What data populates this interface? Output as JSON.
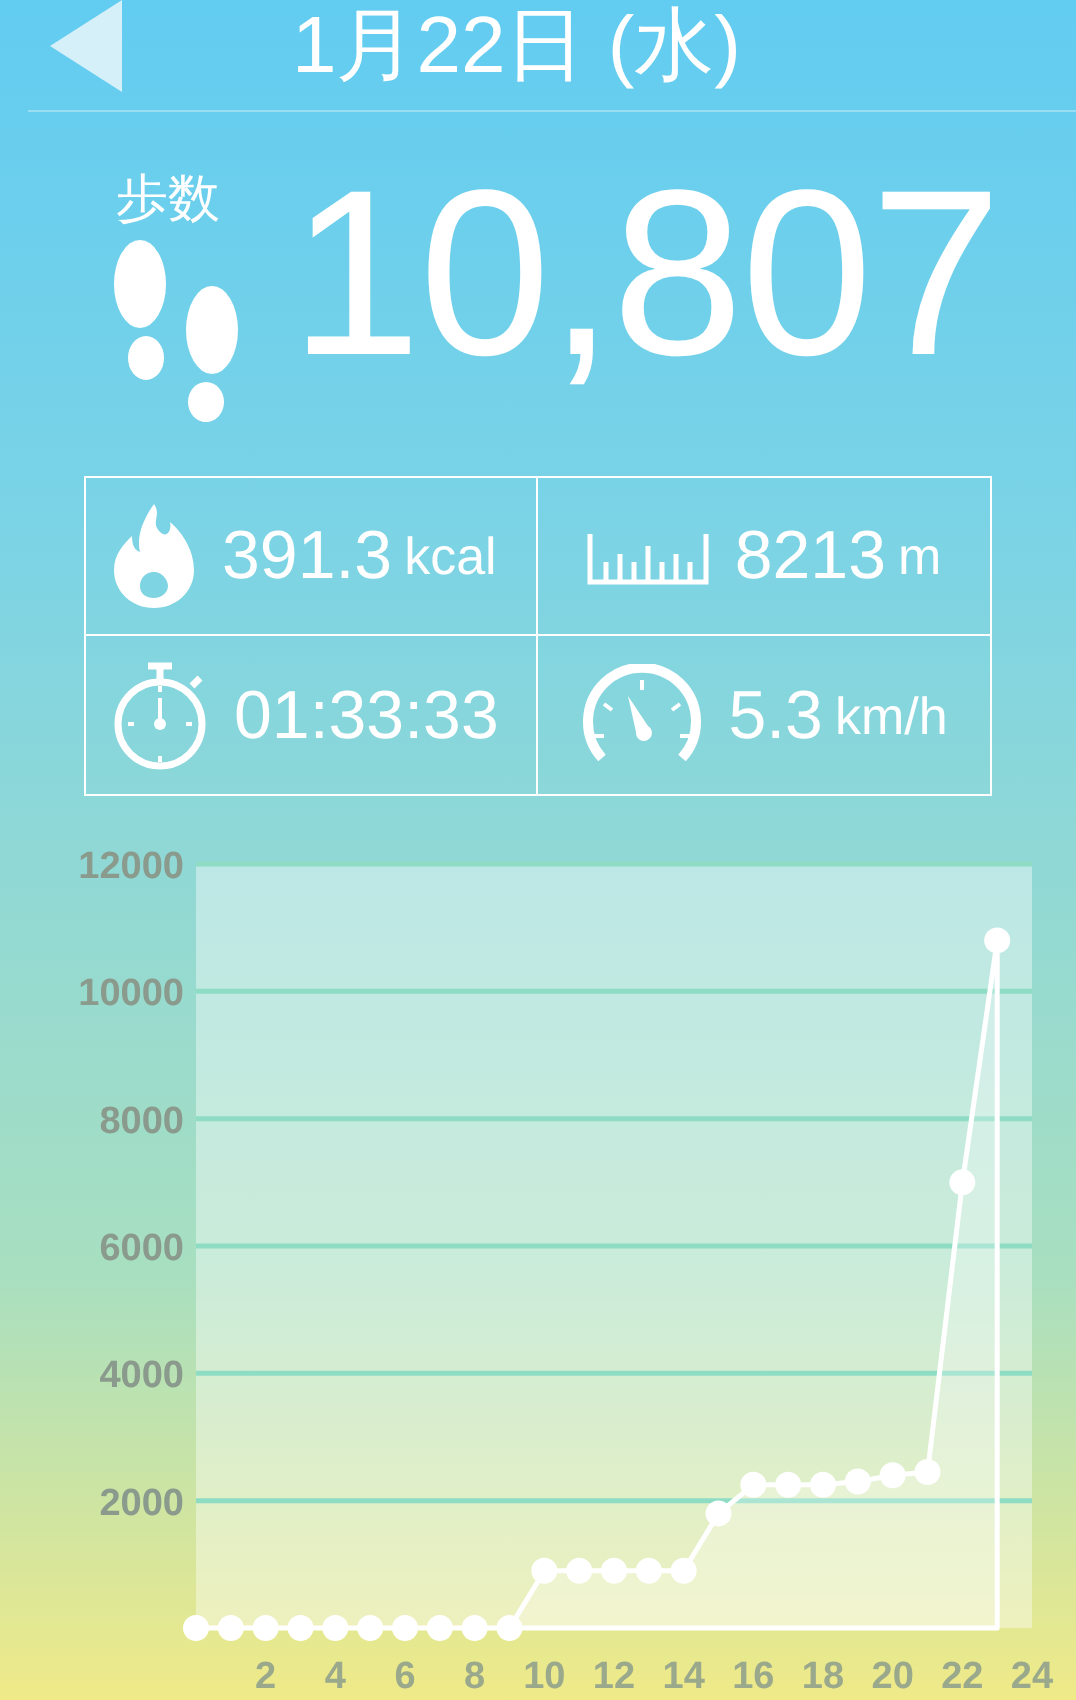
{
  "header": {
    "title": "1月22日 (水)"
  },
  "steps": {
    "label": "歩数",
    "value": "10,807"
  },
  "stats": [
    {
      "kind": "calories",
      "value": "391.3",
      "unit": "kcal"
    },
    {
      "kind": "distance",
      "value": "8213",
      "unit": "m"
    },
    {
      "kind": "time",
      "value": "01:33:33"
    },
    {
      "kind": "speed",
      "value": "5.3",
      "unit": "km/h"
    }
  ],
  "chart": {
    "chart_data": {
      "type": "area",
      "x": [
        0,
        1,
        2,
        3,
        4,
        5,
        6,
        7,
        8,
        9,
        10,
        11,
        12,
        13,
        14,
        15,
        16,
        17,
        18,
        19,
        20,
        21,
        22,
        23
      ],
      "series": [
        {
          "color": "#ffffff",
          "values": [
            0,
            0,
            0,
            0,
            0,
            0,
            0,
            0,
            0,
            0,
            900,
            900,
            900,
            900,
            900,
            1800,
            2250,
            2250,
            2250,
            2300,
            2400,
            2450,
            7000,
            10800
          ]
        }
      ],
      "grid": true,
      "xlim": [
        0,
        24
      ],
      "ylim": [
        0,
        12000
      ],
      "xticks": [
        2,
        4,
        6,
        8,
        10,
        12,
        14,
        16,
        18,
        20,
        22,
        24
      ],
      "yticks": [
        2000,
        4000,
        6000,
        8000,
        10000,
        12000
      ]
    }
  }
}
